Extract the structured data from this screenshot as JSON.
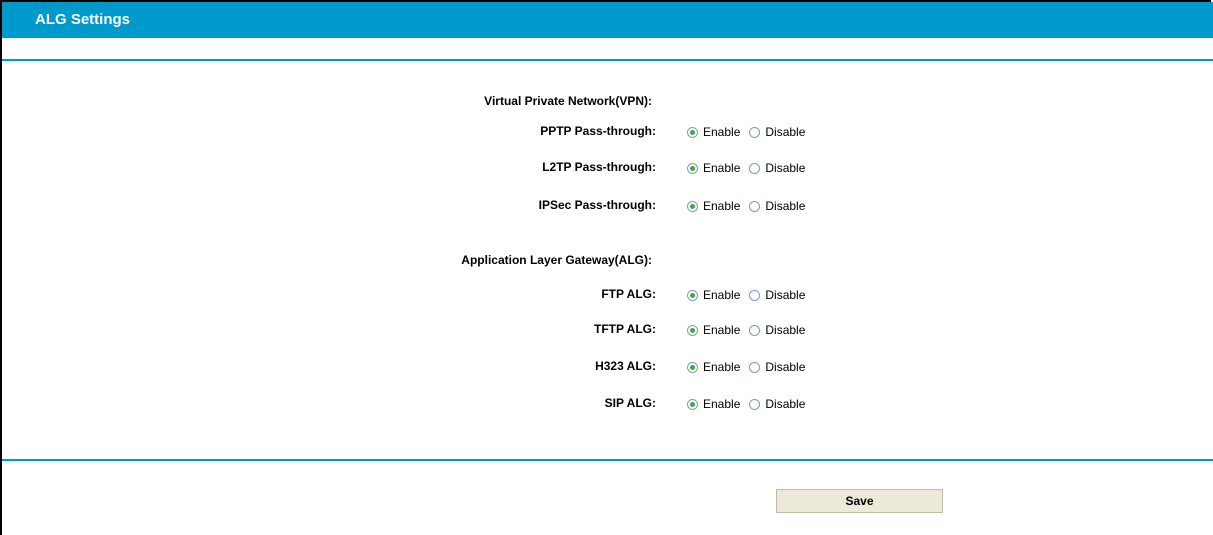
{
  "title": "ALG Settings",
  "vpn_section": {
    "heading": "Virtual Private Network(VPN):",
    "rows": [
      {
        "label": "PPTP Pass-through:",
        "enable": "Enable",
        "disable": "Disable",
        "selected": "enable"
      },
      {
        "label": "L2TP Pass-through:",
        "enable": "Enable",
        "disable": "Disable",
        "selected": "enable"
      },
      {
        "label": "IPSec Pass-through:",
        "enable": "Enable",
        "disable": "Disable",
        "selected": "enable"
      }
    ]
  },
  "alg_section": {
    "heading": "Application Layer Gateway(ALG):",
    "rows": [
      {
        "label": "FTP ALG:",
        "enable": "Enable",
        "disable": "Disable",
        "selected": "enable"
      },
      {
        "label": "TFTP ALG:",
        "enable": "Enable",
        "disable": "Disable",
        "selected": "enable"
      },
      {
        "label": "H323 ALG:",
        "enable": "Enable",
        "disable": "Disable",
        "selected": "enable"
      },
      {
        "label": "SIP ALG:",
        "enable": "Enable",
        "disable": "Disable",
        "selected": "enable"
      }
    ]
  },
  "save_label": "Save",
  "colors": {
    "accent": "#0099cc",
    "button_bg": "#ece9d8",
    "radio_checked": "#3caa3c"
  }
}
